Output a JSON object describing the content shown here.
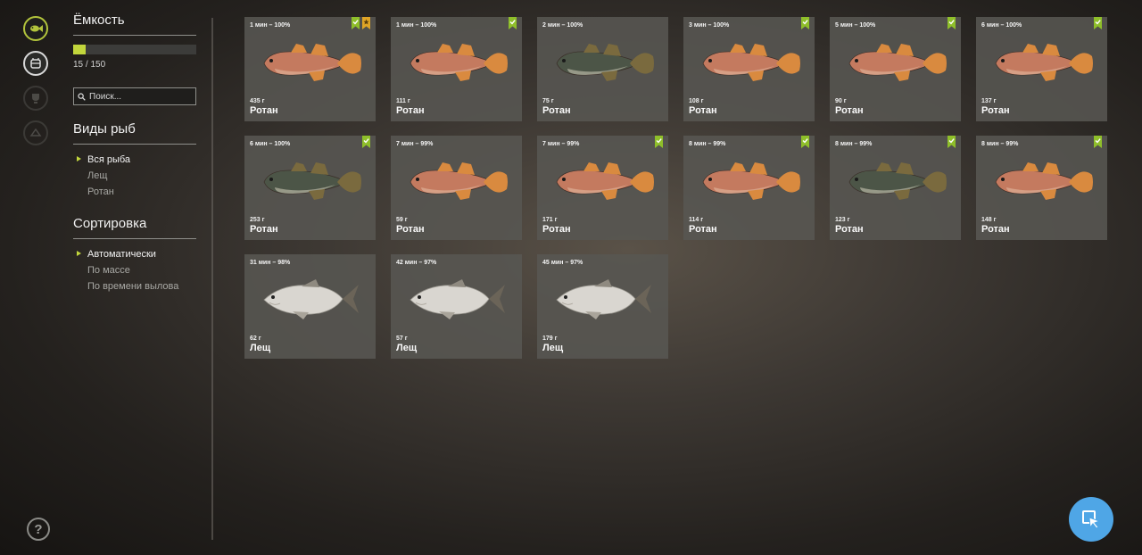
{
  "colors": {
    "accent": "#c2d63c",
    "badge_green": "#8fbf2a",
    "badge_gold": "#e0a526",
    "cursor_button": "#4fa6e6"
  },
  "rail": [
    "fish-icon",
    "keepnet-icon",
    "trophy-icon",
    "record-icon"
  ],
  "panel": {
    "capacity_title": "Ёмкость",
    "capacity_text": "15 / 150",
    "capacity_fraction": 0.1,
    "search_placeholder": "Поиск...",
    "species_title": "Виды рыб",
    "species": [
      "Вся рыба",
      "Лещ",
      "Ротан"
    ],
    "sort_title": "Сортировка",
    "sort": [
      "Автоматически",
      "По массе",
      "По времени вылова"
    ]
  },
  "cards": [
    {
      "time": "1 мин – 100%",
      "weight": "435 г",
      "name": "Ротан",
      "badges": [
        "green",
        "gold"
      ],
      "kind": "rotan-pink"
    },
    {
      "time": "1 мин – 100%",
      "weight": "111 г",
      "name": "Ротан",
      "badges": [
        "green"
      ],
      "kind": "rotan-pink"
    },
    {
      "time": "2 мин – 100%",
      "weight": "75 г",
      "name": "Ротан",
      "badges": [],
      "kind": "rotan-dark"
    },
    {
      "time": "3 мин – 100%",
      "weight": "108 г",
      "name": "Ротан",
      "badges": [
        "green"
      ],
      "kind": "rotan-pink"
    },
    {
      "time": "5 мин – 100%",
      "weight": "90 г",
      "name": "Ротан",
      "badges": [
        "green"
      ],
      "kind": "rotan-pink"
    },
    {
      "time": "6 мин – 100%",
      "weight": "137 г",
      "name": "Ротан",
      "badges": [
        "green"
      ],
      "kind": "rotan-pink"
    },
    {
      "time": "6 мин – 100%",
      "weight": "253 г",
      "name": "Ротан",
      "badges": [
        "green"
      ],
      "kind": "rotan-dark"
    },
    {
      "time": "7 мин – 99%",
      "weight": "59 г",
      "name": "Ротан",
      "badges": [],
      "kind": "rotan-pink"
    },
    {
      "time": "7 мин – 99%",
      "weight": "171 г",
      "name": "Ротан",
      "badges": [
        "green"
      ],
      "kind": "rotan-pink"
    },
    {
      "time": "8 мин – 99%",
      "weight": "114 г",
      "name": "Ротан",
      "badges": [
        "green"
      ],
      "kind": "rotan-pink"
    },
    {
      "time": "8 мин – 99%",
      "weight": "123 г",
      "name": "Ротан",
      "badges": [
        "green"
      ],
      "kind": "rotan-dark"
    },
    {
      "time": "8 мин – 99%",
      "weight": "148 г",
      "name": "Ротан",
      "badges": [
        "green"
      ],
      "kind": "rotan-pink"
    },
    {
      "time": "31 мин – 98%",
      "weight": "62 г",
      "name": "Лещ",
      "badges": [],
      "kind": "bream"
    },
    {
      "time": "42 мин – 97%",
      "weight": "57 г",
      "name": "Лещ",
      "badges": [],
      "kind": "bream"
    },
    {
      "time": "45 мин – 97%",
      "weight": "179 г",
      "name": "Лещ",
      "badges": [],
      "kind": "bream"
    }
  ]
}
